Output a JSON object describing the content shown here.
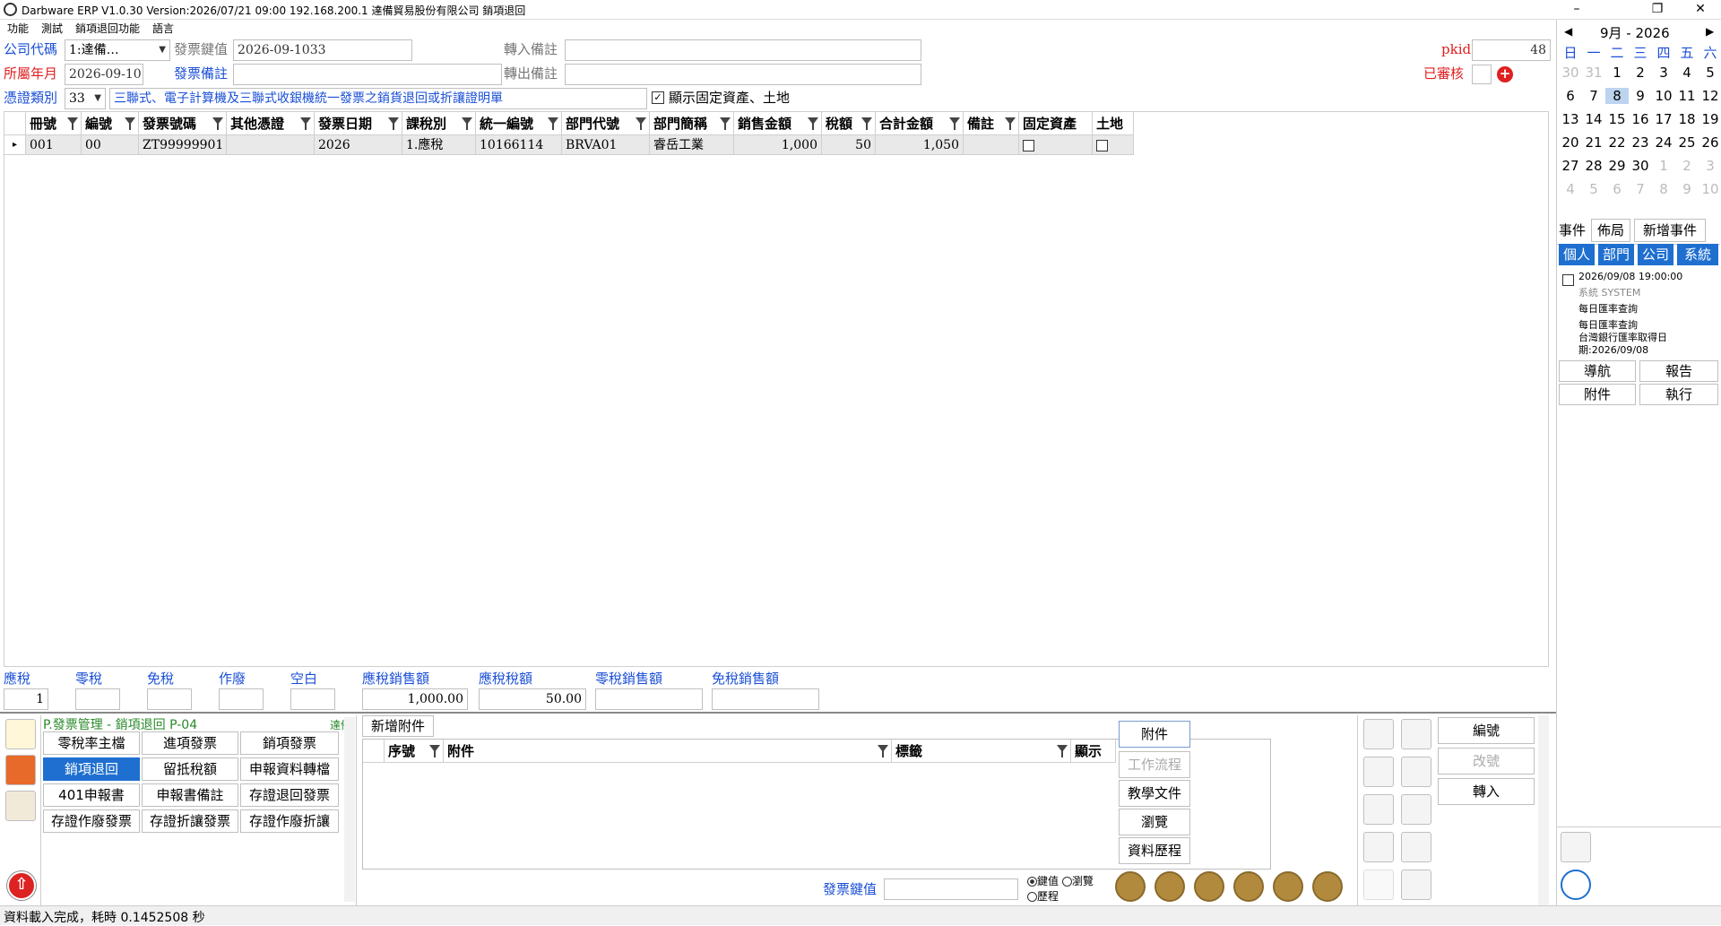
{
  "title": "Darbware ERP V1.0.30 Version:2026/07/21 09:00    192.168.200.1 達備貿易股份有限公司 銷項退回",
  "menu": [
    "功能",
    "測試",
    "銷項退回功能",
    "語言"
  ],
  "form": {
    "company_label": "公司代碼",
    "company_value": "1:達備…",
    "invoice_key_label": "發票鍵值",
    "invoice_key_value": "2026-09-1033",
    "import_note_label": "轉入備註",
    "pkid_label": "pkid",
    "pkid_value": "48",
    "period_label": "所屬年月",
    "period_value": "2026-09-10",
    "invoice_note_label": "發票備註",
    "export_note_label": "轉出備註",
    "approved_label": "已審核",
    "voucher_type_label": "憑證類別",
    "voucher_type_value": "33",
    "voucher_desc": "三聯式、電子計算機及三聯式收銀機統一發票之銷貨退回或折讓證明單",
    "fixed_asset_checkbox_label": "顯示固定資產、土地"
  },
  "grid": {
    "columns": [
      "冊號",
      "編號",
      "發票號碼",
      "其他憑證",
      "發票日期",
      "課稅別",
      "統一編號",
      "部門代號",
      "部門簡稱",
      "銷售金額",
      "稅額",
      "合計金額",
      "備註",
      "固定資產",
      "土地"
    ],
    "rows": [
      [
        "001",
        "00",
        "ZT99999901",
        "",
        "2026",
        "1.應稅",
        "10166114",
        "BRVA01",
        "睿岳工業",
        "1,000",
        "50",
        "1,050",
        "",
        "",
        ""
      ]
    ]
  },
  "summary": {
    "labels": [
      "應稅",
      "零稅",
      "免稅",
      "作廢",
      "空白",
      "應稅銷售額",
      "應稅稅額",
      "零稅銷售額",
      "免稅銷售額"
    ],
    "values": [
      "1",
      "",
      "",
      "",
      "",
      "1,000.00",
      "50.00",
      "",
      ""
    ]
  },
  "module": {
    "title": "P.發票管理 - 銷項退回  P-04",
    "company_tag": "達備",
    "buttons": [
      "零稅率主檔",
      "進項發票",
      "銷項發票",
      "銷項退回",
      "留抵稅額",
      "申報資料轉檔",
      "401申報書",
      "申報書備註",
      "存證退回發票",
      "存證作廢發票",
      "存證折讓發票",
      "存證作廢折讓"
    ]
  },
  "attach": {
    "add_button": "新增附件",
    "columns": [
      "序號",
      "附件",
      "標籤",
      "顯示"
    ],
    "side_buttons": [
      "附件",
      "工作流程",
      "教學文件",
      "瀏覽",
      "資料歷程"
    ],
    "key_label": "發票鍵值",
    "radio_options": [
      "鍵值",
      "瀏覽",
      "歷程"
    ]
  },
  "right_actions": [
    "編號",
    "改號",
    "轉入"
  ],
  "calendar": {
    "month_label": "9月 - 2026",
    "weekdays": [
      "日",
      "一",
      "二",
      "三",
      "四",
      "五",
      "六"
    ],
    "weeks": [
      [
        "30",
        "31",
        "1",
        "2",
        "3",
        "4",
        "5"
      ],
      [
        "6",
        "7",
        "8",
        "9",
        "10",
        "11",
        "12"
      ],
      [
        "13",
        "14",
        "15",
        "16",
        "17",
        "18",
        "19"
      ],
      [
        "20",
        "21",
        "22",
        "23",
        "24",
        "25",
        "26"
      ],
      [
        "27",
        "28",
        "29",
        "30",
        "1",
        "2",
        "3"
      ],
      [
        "4",
        "5",
        "6",
        "7",
        "8",
        "9",
        "10"
      ]
    ],
    "selected": "8"
  },
  "events": {
    "tabs": [
      "事件",
      "佈局",
      "新增事件"
    ],
    "filters": [
      "個人",
      "部門",
      "公司",
      "系統"
    ],
    "item_time": "2026/09/08 19:00:00",
    "item_source": "系統  SYSTEM",
    "item_lines": [
      "每日匯率查詢",
      "每日匯率查詢",
      "台灣銀行匯率取得日",
      "期:2026/09/08"
    ],
    "actions": [
      "導航",
      "報告",
      "附件",
      "執行"
    ]
  },
  "status_text": "資料載入完成，耗時 0.1452508 秒",
  "colors": {
    "accent": "#1e6fd0",
    "label_blue": "#1a4fd6",
    "label_red": "#e02020",
    "nav_gold": "#b28a3e"
  }
}
